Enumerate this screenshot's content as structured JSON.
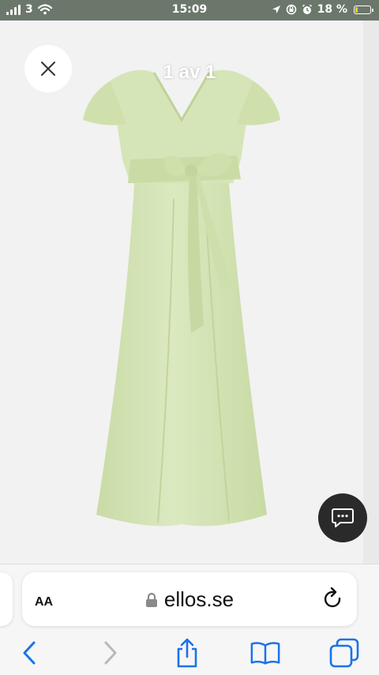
{
  "status_bar": {
    "carrier": "3",
    "time": "15:09",
    "battery": "18 %",
    "battery_level": 0.18,
    "icons": [
      "signal-icon",
      "wifi-icon",
      "location-icon",
      "lock-rotation-icon",
      "alarm-icon",
      "battery-icon"
    ]
  },
  "viewer": {
    "counter": "1 av 1",
    "close_icon": "close-icon",
    "chat_icon": "chat-icon",
    "product_image": "green-maxi-dress"
  },
  "browser": {
    "text_size_label": "AA",
    "url": "ellos.se",
    "icons": [
      "lock-icon",
      "reload-icon",
      "back-icon",
      "forward-icon",
      "share-icon",
      "bookmarks-icon",
      "tabs-icon"
    ]
  },
  "colors": {
    "accent": "#1a73e8",
    "dress": "#d5e4b5",
    "status_bar": "#6b776b"
  }
}
